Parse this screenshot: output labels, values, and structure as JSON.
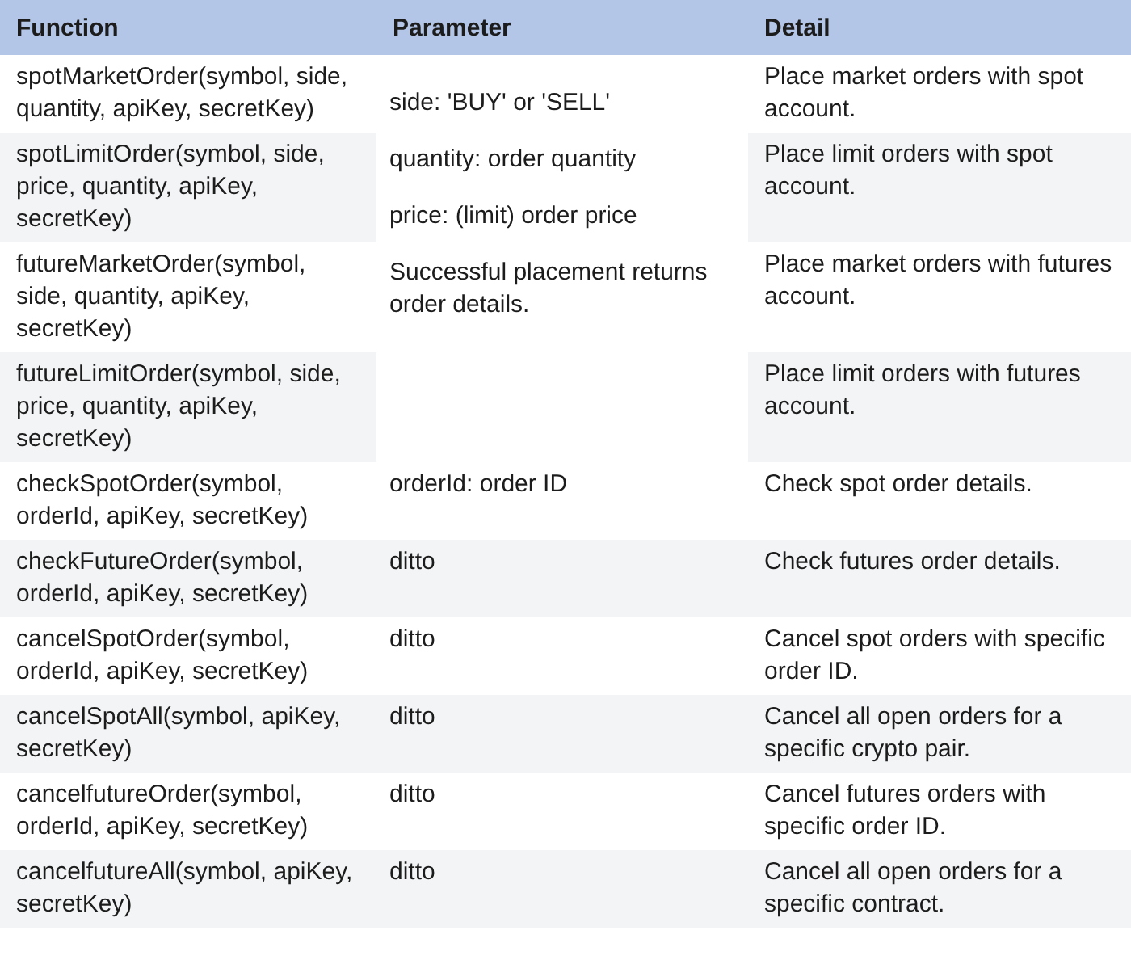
{
  "columns": [
    "Function",
    "Parameter",
    "Detail"
  ],
  "row_groups": [
    {
      "parameter_lines": [
        "side: 'BUY' or 'SELL'",
        "quantity: order quantity",
        "price: (limit) order price",
        "Successful placement returns order details."
      ],
      "rows": [
        {
          "function": "spotMarketOrder(symbol, side, quantity, apiKey, secretKey)",
          "detail": "Place market orders with spot account.",
          "shaded": false
        },
        {
          "function": "spotLimitOrder(symbol, side, price, quantity, apiKey, secretKey)",
          "detail": "Place limit orders with spot account.",
          "shaded": true
        },
        {
          "function": "futureMarketOrder(symbol, side, quantity, apiKey, secretKey)",
          "detail": "Place market orders with futures account.",
          "shaded": false
        },
        {
          "function": "futureLimitOrder(symbol, side, price, quantity, apiKey, secretKey)",
          "detail": "Place limit orders with futures account.",
          "shaded": true
        }
      ]
    },
    {
      "parameter_lines": [
        "orderId: order ID"
      ],
      "rows": [
        {
          "function": "checkSpotOrder(symbol, orderId, apiKey, secretKey)",
          "detail": "Check spot order details.",
          "shaded": false
        }
      ]
    },
    {
      "parameter_lines": [
        "ditto"
      ],
      "rows": [
        {
          "function": "checkFutureOrder(symbol, orderId, apiKey, secretKey)",
          "detail": "Check futures order details.",
          "shaded": true
        }
      ]
    },
    {
      "parameter_lines": [
        "ditto"
      ],
      "rows": [
        {
          "function": "cancelSpotOrder(symbol, orderId, apiKey, secretKey)",
          "detail": "Cancel spot orders with specific order ID.",
          "shaded": false
        }
      ]
    },
    {
      "parameter_lines": [
        "ditto"
      ],
      "rows": [
        {
          "function": "cancelSpotAll(symbol, apiKey, secretKey)",
          "detail": "Cancel all open orders for a specific crypto pair.",
          "shaded": true
        }
      ]
    },
    {
      "parameter_lines": [
        "ditto"
      ],
      "rows": [
        {
          "function": "cancelfutureOrder(symbol, orderId, apiKey, secretKey)",
          "detail": "Cancel futures orders with specific order ID.",
          "shaded": false
        }
      ]
    },
    {
      "parameter_lines": [
        "ditto"
      ],
      "rows": [
        {
          "function": "cancelfutureAll(symbol, apiKey, secretKey)",
          "detail": "Cancel all open orders for a specific contract.",
          "shaded": true
        }
      ]
    }
  ]
}
